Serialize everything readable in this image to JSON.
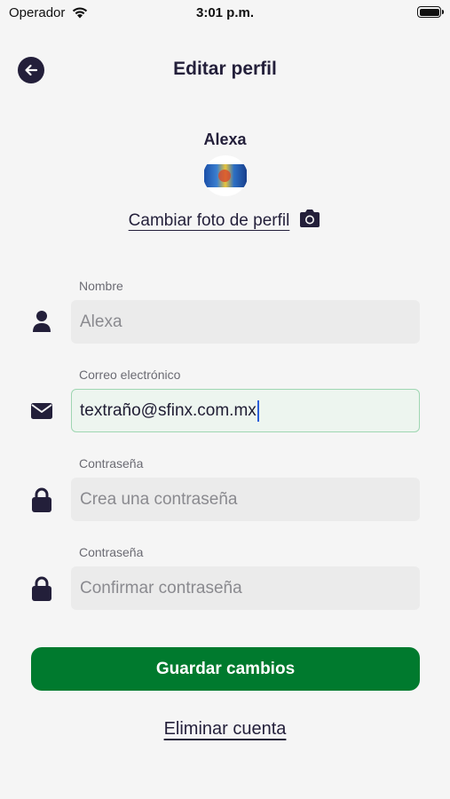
{
  "status_bar": {
    "carrier": "Operador",
    "time": "3:01 p.m."
  },
  "header": {
    "title": "Editar perfil"
  },
  "profile": {
    "name": "Alexa",
    "change_photo_label": "Cambiar foto de perfil"
  },
  "form": {
    "name": {
      "label": "Nombre",
      "value": "",
      "placeholder": "Alexa"
    },
    "email": {
      "label": "Correo electrónico",
      "value": "textraño@sfinx.com.mx"
    },
    "password": {
      "label": "Contraseña",
      "value": "",
      "placeholder": "Crea una contraseña"
    },
    "confirm_password": {
      "label": "Contraseña",
      "value": "",
      "placeholder": "Confirmar contraseña"
    }
  },
  "actions": {
    "save_label": "Guardar cambios",
    "delete_label": "Eliminar cuenta"
  },
  "colors": {
    "primary": "#007a2e",
    "dark": "#231f3a",
    "background": "#f5f5f5",
    "field_background": "#ebebeb",
    "active_border": "#9fd6b2"
  },
  "icons": {
    "back": "arrow-left-icon",
    "camera": "camera-icon",
    "user": "user-icon",
    "email": "envelope-icon",
    "lock": "lock-icon"
  }
}
